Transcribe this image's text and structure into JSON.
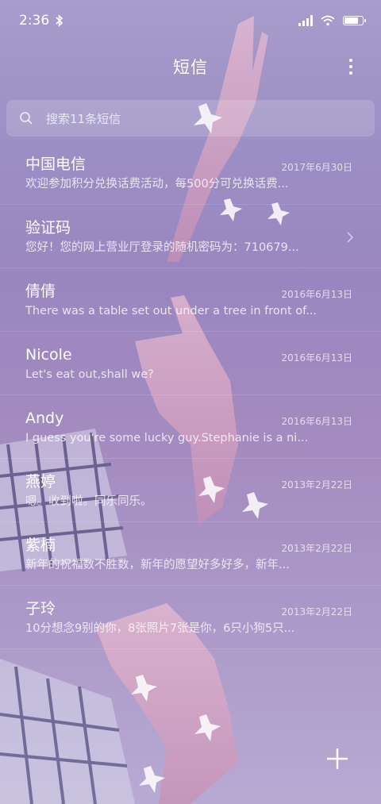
{
  "status_bar": {
    "time": "2:36",
    "icons": [
      "bluetooth-icon",
      "signal-icon",
      "wifi-icon",
      "battery-icon"
    ]
  },
  "header": {
    "title": "短信",
    "more_icon": "more-vertical-icon"
  },
  "search": {
    "placeholder": "搜索11条短信",
    "icon": "search-icon"
  },
  "conversations": [
    {
      "name": "中国电信",
      "date": "2017年6月30日",
      "preview": "欢迎参加积分兑换话费活动，每500分可兑换话费..."
    },
    {
      "name": "验证码",
      "date": "",
      "preview": "您好！您的网上营业厅登录的随机密码为：710679...",
      "has_chevron": true
    },
    {
      "name": "倩倩",
      "date": "2016年6月13日",
      "preview": "There was a table set out under a tree in front of..."
    },
    {
      "name": "Nicole",
      "date": "2016年6月13日",
      "preview": "Let's eat out,shall we?"
    },
    {
      "name": "Andy",
      "date": "2016年6月13日",
      "preview": "I guess you're some lucky guy.Stephanie is a ni..."
    },
    {
      "name": "燕婷",
      "date": "2013年2月22日",
      "preview": "嗯。收到啦。同乐同乐。"
    },
    {
      "name": "紫楠",
      "date": "2013年2月22日",
      "preview": "新年的祝福数不胜数，新年的愿望好多好多，新年..."
    },
    {
      "name": "子玲",
      "date": "2013年2月22日",
      "preview": "10分想念9别的你，8张照片7张是你，6只小狗5只..."
    }
  ],
  "fab": {
    "icon": "plus-icon"
  },
  "colors": {
    "background_top": "#a89ccc",
    "background_bottom": "#b7aad3",
    "text": "#ffffff"
  }
}
